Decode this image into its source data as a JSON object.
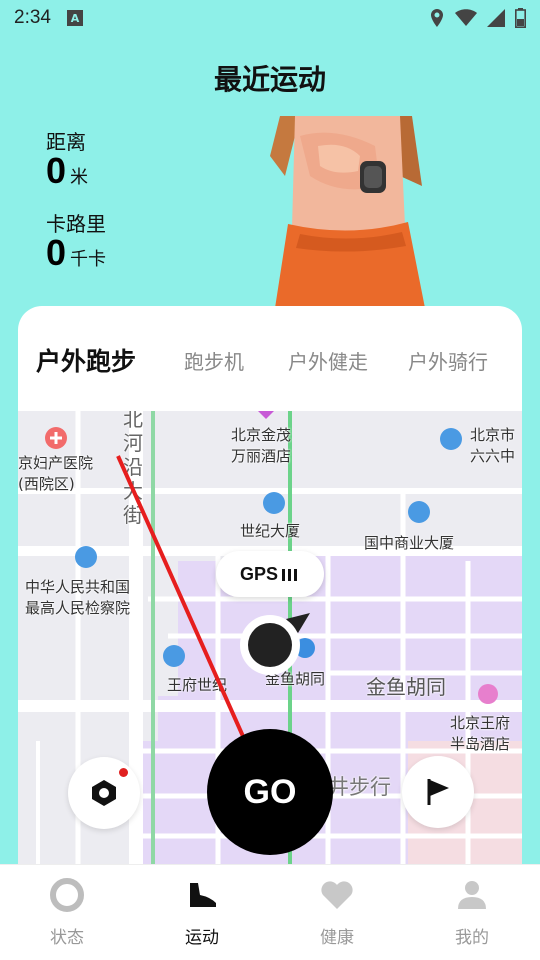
{
  "status_bar": {
    "time": "2:34",
    "icons": [
      "a-icon",
      "location-icon",
      "wifi-icon",
      "signal-icon",
      "battery-icon"
    ]
  },
  "page_title": "最近运动",
  "stats": {
    "distance": {
      "label": "距离",
      "value": "0",
      "unit": "米"
    },
    "calories": {
      "label": "卡路里",
      "value": "0",
      "unit": "千卡"
    }
  },
  "tabs": [
    "户外跑步",
    "跑步机",
    "户外健走",
    "户外骑行"
  ],
  "map": {
    "labels": {
      "hospital": "京妇产医院\n(西院区)",
      "road1": "北\n河\n沿\n大\n街",
      "hotel1": "北京金茂\n万丽酒店",
      "school": "北京市\n六六中",
      "century": "世纪大厦",
      "commerce": "国中商业大厦",
      "court": "中华人民共和国\n最高人民检察院",
      "wangfu": "王府世纪",
      "hutong_small": "金鱼胡同",
      "hutong_big": "金鱼胡同",
      "peninsula": "北京王府\n半岛酒店",
      "pedestrian": "井步行"
    },
    "gps_label": "GPS"
  },
  "go_label": "GO",
  "nav": [
    {
      "label": "状态",
      "icon": "status-ring-icon"
    },
    {
      "label": "运动",
      "icon": "shoe-icon"
    },
    {
      "label": "健康",
      "icon": "heart-icon"
    },
    {
      "label": "我的",
      "icon": "person-icon"
    }
  ],
  "colors": {
    "background": "#8ef0e8",
    "accent": "#000000",
    "map_block": "#e4d8f7",
    "route": "#e02020"
  }
}
